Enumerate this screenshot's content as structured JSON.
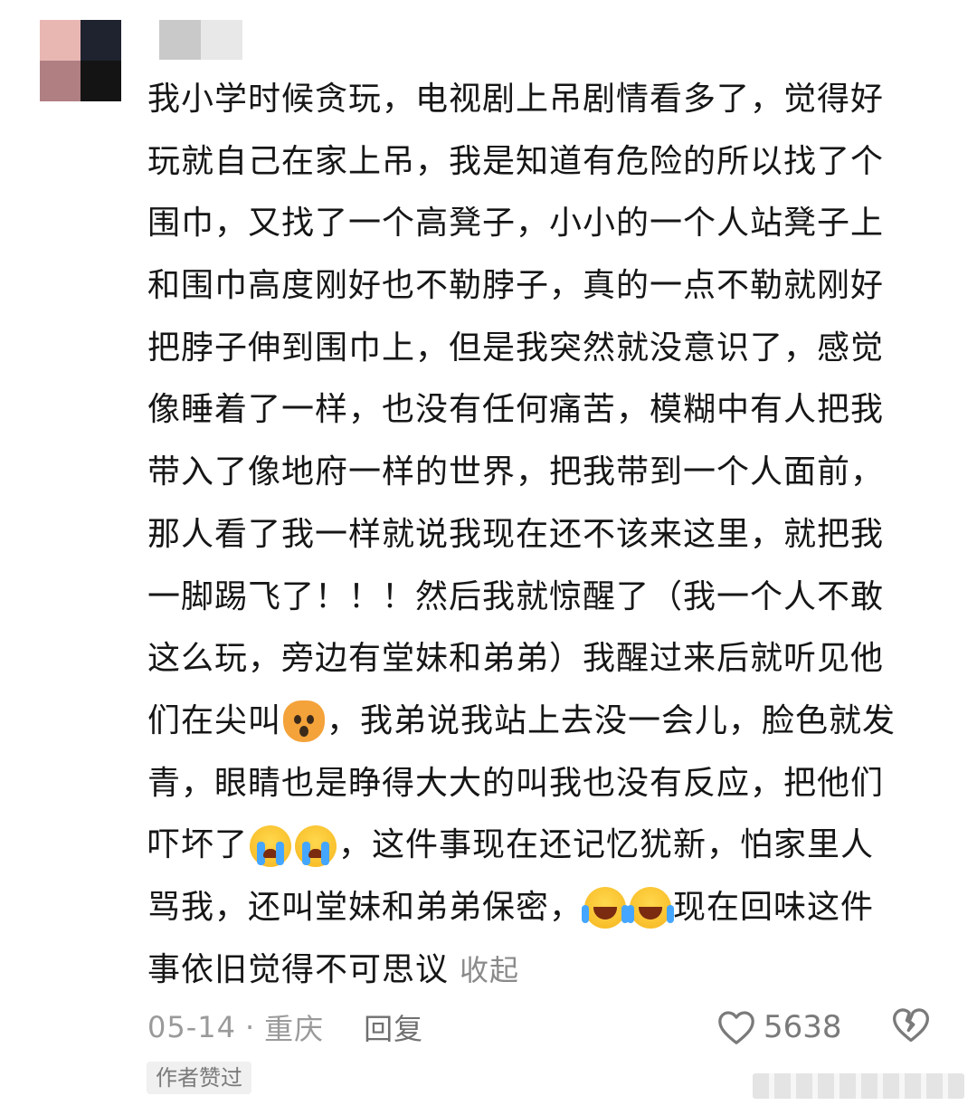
{
  "colors": {
    "avatar_tiles": [
      "#e9b7b2",
      "#1f2330",
      "#b07f82",
      "#141414"
    ],
    "username_blur": [
      "#c9c9c9",
      "#e8e8e8"
    ],
    "text": "#161616",
    "muted": "#9a9a9a"
  },
  "comment": {
    "lines": [
      "我小学时候贪玩，电视剧上吊剧情看多了，觉得好",
      "玩就自己在家上吊，我是知道有危险的所以找了个",
      "围巾，又找了一个高凳子，小小的一个人站凳子上",
      "和围巾高度刚好也不勒脖子，真的一点不勒就刚好",
      "把脖子伸到围巾上，但是我突然就没意识了，感觉",
      "像睡着了一样，也没有任何痛苦，模糊中有人把我",
      "带入了像地府一样的世界，把我带到一个人面前，",
      "那人看了我一样就说我现在还不该来这里，就把我",
      "一脚踢飞了！！！然后我就惊醒了（我一个人不敢",
      "这么玩，旁边有堂妹和弟弟）我醒过来后就听见他"
    ],
    "line11_a": "们在尖叫",
    "line11_b": "，我弟说我站上去没一会儿，脸色就发",
    "line12": "青，眼睛也是睁得大大的叫我也没有反应，把他们",
    "line13_a": "吓坏了",
    "line13_b": "，这件事现在还记忆犹新，怕家里人",
    "line14_a": "骂我，还叫堂妹和弟弟保密，",
    "line14_b": "现在回味这件",
    "line15": "事依旧觉得不可思议",
    "collapse_label": "收起",
    "emoji_names": [
      "scream-cat-icon",
      "loudly-crying-icon",
      "rolling-laugh-icon"
    ]
  },
  "meta": {
    "date": "05-14",
    "dot": "·",
    "location": "重庆",
    "reply_label": "回复"
  },
  "like": {
    "count": "5638",
    "icon": "heart-outline-icon"
  },
  "dislike": {
    "icon": "broken-heart-icon"
  },
  "badge": "作者赞过"
}
